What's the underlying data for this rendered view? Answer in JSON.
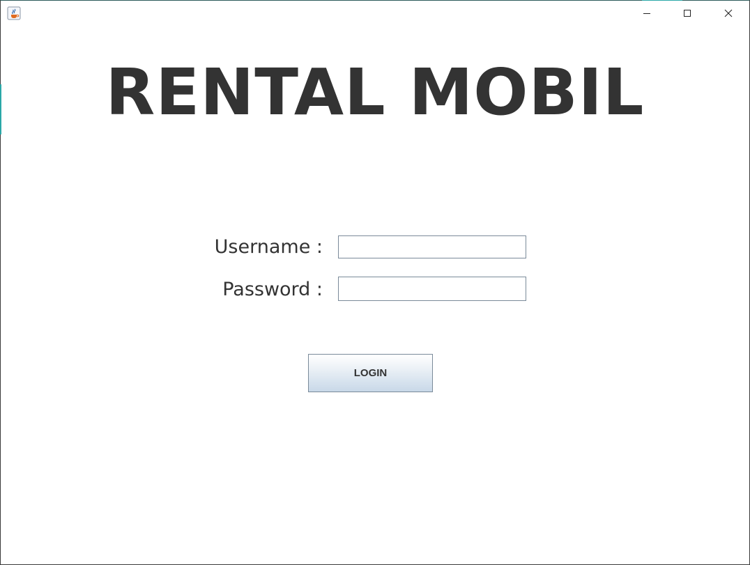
{
  "window": {
    "controls": {
      "minimize_icon": "minimize-icon",
      "maximize_icon": "maximize-icon",
      "close_icon": "close-icon"
    },
    "app_icon": "java-app-icon"
  },
  "main": {
    "heading": "RENTAL MOBIL",
    "form": {
      "username_label": "Username :",
      "username_value": "",
      "password_label": "Password :",
      "password_value": "",
      "login_label": "LOGIN"
    }
  },
  "colors": {
    "text": "#333333",
    "field_border": "#7a8a99",
    "button_gradient_top": "#ffffff",
    "button_gradient_bottom": "#c8d8e8",
    "window_accent": "#2aa8a8"
  }
}
